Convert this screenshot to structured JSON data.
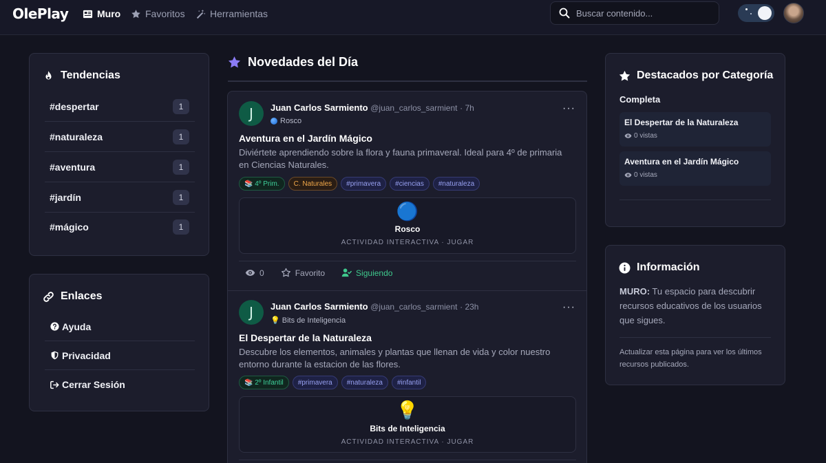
{
  "app": {
    "logo": "OlePlay"
  },
  "nav": {
    "items": [
      {
        "label": "Muro",
        "icon": "newspaper-icon",
        "active": true
      },
      {
        "label": "Favoritos",
        "icon": "star-icon",
        "active": false
      },
      {
        "label": "Herramientas",
        "icon": "magic-wand-icon",
        "active": false
      }
    ],
    "search_placeholder": "Buscar contenido..."
  },
  "trends": {
    "title": "Tendencias",
    "items": [
      {
        "tag": "#despertar",
        "count": "1"
      },
      {
        "tag": "#naturaleza",
        "count": "1"
      },
      {
        "tag": "#aventura",
        "count": "1"
      },
      {
        "tag": "#jardín",
        "count": "1"
      },
      {
        "tag": "#mágico",
        "count": "1"
      }
    ]
  },
  "links": {
    "title": "Enlaces",
    "items": [
      {
        "label": "Ayuda",
        "icon": "question-circle-icon"
      },
      {
        "label": "Privacidad",
        "icon": "shield-icon"
      },
      {
        "label": "Cerrar Sesión",
        "icon": "logout-icon"
      }
    ]
  },
  "feed": {
    "title": "Novedades del Día",
    "posts": [
      {
        "avatar_letter": "J",
        "author": "Juan Carlos Sarmiento",
        "handle": "@juan_carlos_sarmient",
        "time": "· 7h",
        "activity_label": "Rosco",
        "title": "Aventura en el Jardín Mágico",
        "description": "Diviértete aprendiendo sobre la flora y fauna primaveral. Ideal para 4º de primaria en Ciencias Naturales.",
        "tags": [
          {
            "text": "📚 4º Prim.",
            "kind": "level"
          },
          {
            "text": "C. Naturales",
            "kind": "subject"
          },
          {
            "text": "#primavera",
            "kind": "hash"
          },
          {
            "text": "#ciencias",
            "kind": "hash"
          },
          {
            "text": "#naturaleza",
            "kind": "hash"
          }
        ],
        "activity_icon": "🔵",
        "activity_name": "Rosco",
        "activity_type": "ACTIVIDAD INTERACTIVA · JUGAR",
        "views": "0",
        "favorite_label": "Favorito",
        "follow_label": "Siguiendo"
      },
      {
        "avatar_letter": "J",
        "author": "Juan Carlos Sarmiento",
        "handle": "@juan_carlos_sarmient",
        "time": "· 23h",
        "activity_label": "💡 Bits de Inteligencia",
        "title": "El Despertar de la Naturaleza",
        "description": "Descubre los elementos, animales y plantas que llenan de vida y color nuestro entorno durante la estacion de las flores.",
        "tags": [
          {
            "text": "📚 2º Infantil",
            "kind": "level"
          },
          {
            "text": "#primavera",
            "kind": "hash"
          },
          {
            "text": "#naturaleza",
            "kind": "hash"
          },
          {
            "text": "#infantil",
            "kind": "hash"
          }
        ],
        "activity_icon": "💡",
        "activity_name": "Bits de Inteligencia",
        "activity_type": "ACTIVIDAD INTERACTIVA · JUGAR"
      }
    ]
  },
  "featured": {
    "title": "Destacados por Categoría",
    "category": "Completa",
    "items": [
      {
        "title": "El Despertar de la Naturaleza",
        "views": "0 vistas"
      },
      {
        "title": "Aventura en el Jardín Mágico",
        "views": "0 vistas"
      }
    ]
  },
  "info": {
    "title": "Información",
    "lead": "MURO:",
    "text": " Tu espacio para descubrir recursos educativos de los usuarios que sigues.",
    "note": "Actualizar esta página para ver los últimos recursos publicados."
  }
}
